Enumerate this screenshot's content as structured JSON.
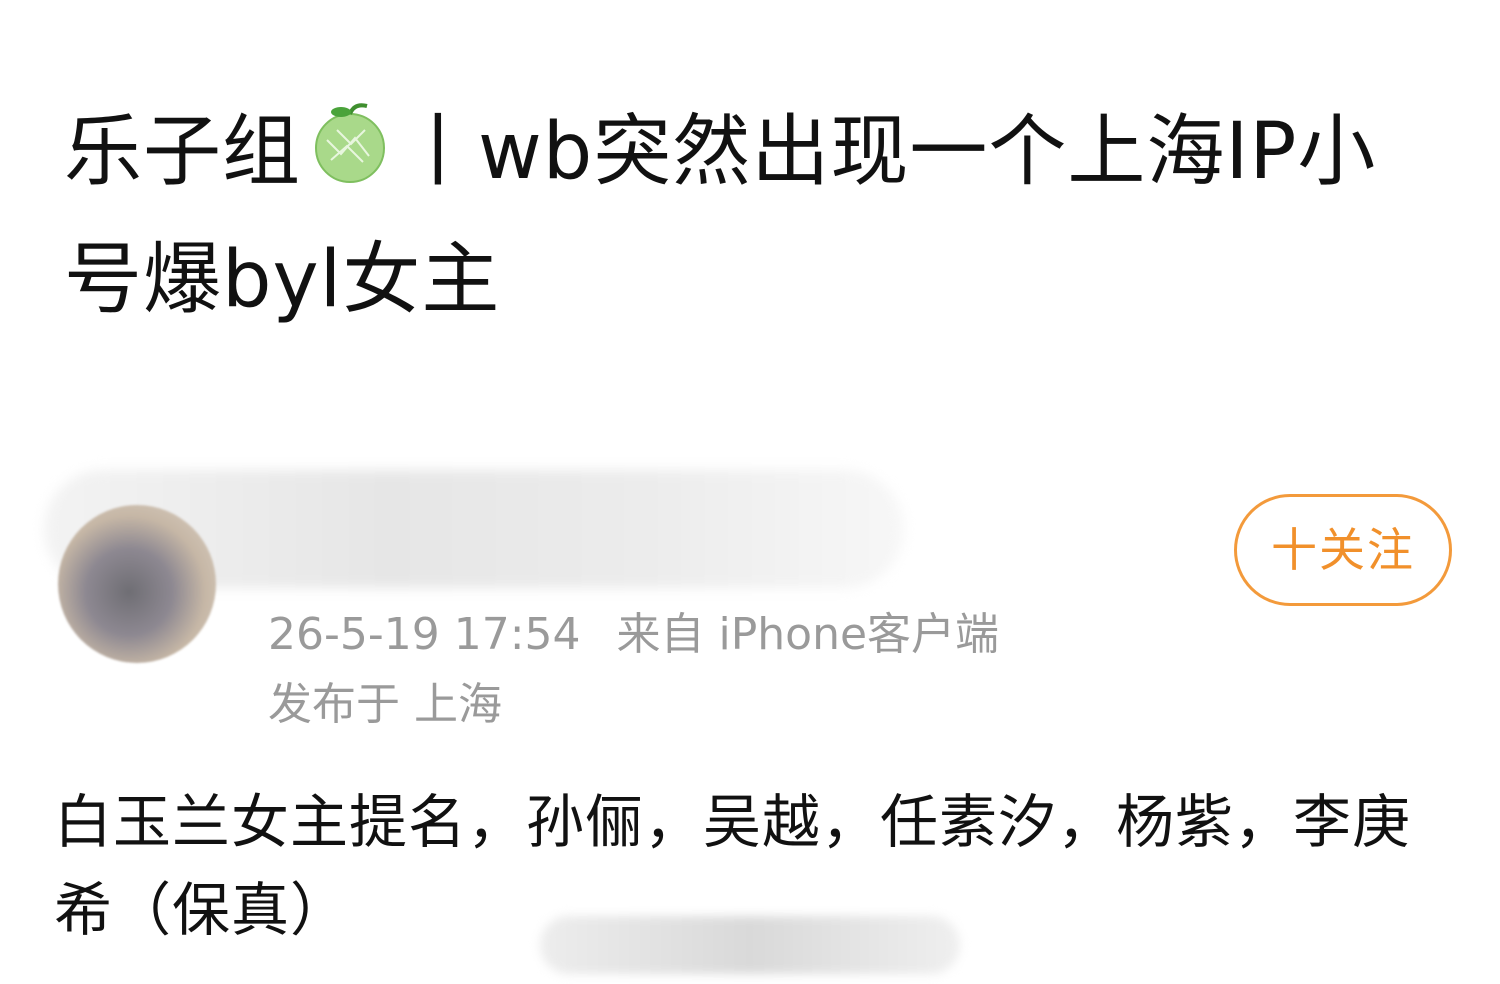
{
  "post": {
    "title_prefix": "乐子组",
    "title_suffix": "丨wb突然出现一个上海IP小号爆byl女主",
    "melon_emoji_name": "melon-icon",
    "follow_label": "十关注",
    "timestamp": "26-5-19 17:54",
    "source": "来自 iPhone客户端",
    "location": "发布于 上海",
    "body": "白玉兰女主提名，孙俪，吴越，任素汐，杨紫，李庚希（保真）"
  },
  "colors": {
    "accent": "#f1902b",
    "meta": "#9a9a9a"
  }
}
